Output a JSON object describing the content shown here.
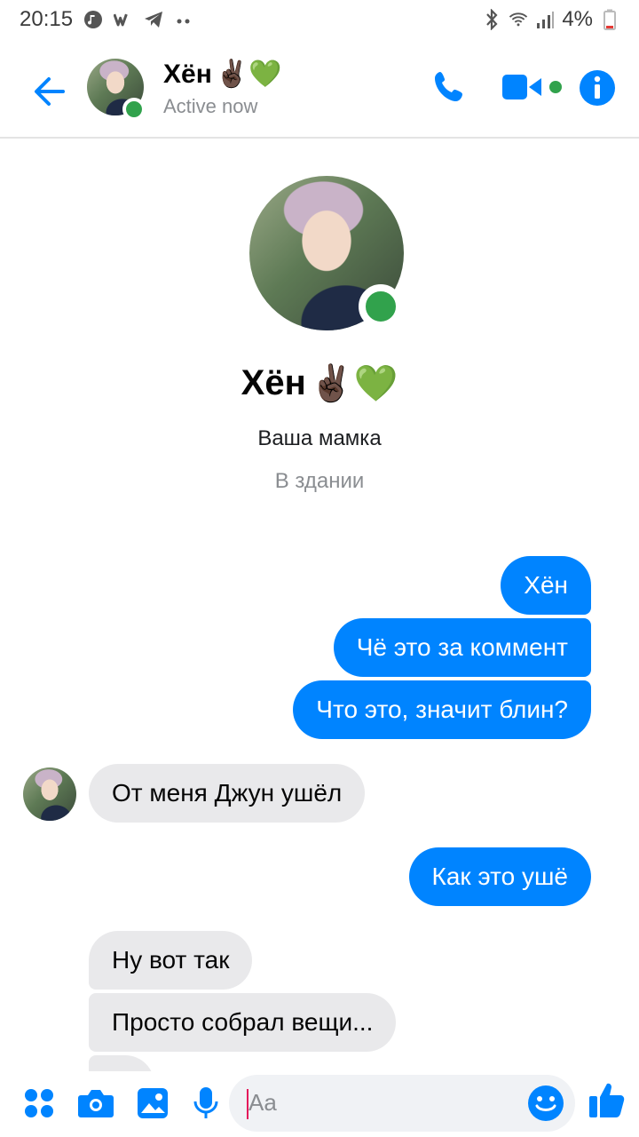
{
  "status_bar": {
    "time": "20:15",
    "battery": "4%",
    "icons": [
      "music-icon",
      "w-icon",
      "telegram-icon",
      "more-dots-icon",
      "bluetooth-icon",
      "wifi-icon",
      "signal-icon",
      "battery-icon"
    ]
  },
  "header": {
    "contact_name": "Хён",
    "name_emoji": "✌🏿💚",
    "status": "Active now"
  },
  "profile": {
    "name": "Хён",
    "name_emoji": "✌🏿💚",
    "subtitle": "Ваша мамка",
    "location": "В здании"
  },
  "messages": [
    {
      "direction": "out",
      "text": "Хён"
    },
    {
      "direction": "out",
      "text": "Чё это за коммент"
    },
    {
      "direction": "out",
      "text": "Что это, значит блин?"
    },
    {
      "direction": "in",
      "text": "От меня Джун ушёл"
    },
    {
      "direction": "out",
      "text": "Как это ушё"
    },
    {
      "direction": "in",
      "text": "Ну вот так"
    },
    {
      "direction": "in",
      "text": "Просто собрал вещи..."
    }
  ],
  "composer": {
    "placeholder": "Aa"
  },
  "colors": {
    "accent": "#0084ff",
    "online": "#31a24c",
    "incoming_bubble": "#e9e9eb"
  }
}
